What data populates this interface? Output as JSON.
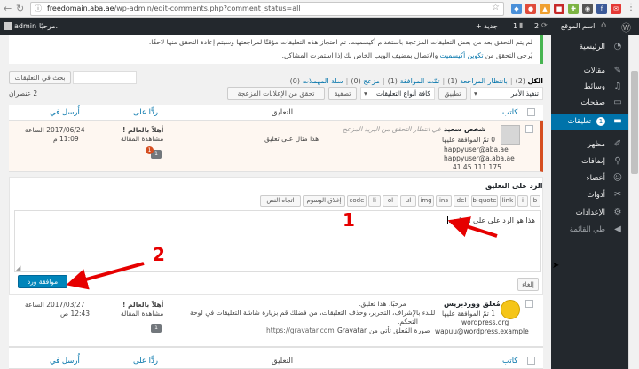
{
  "browser": {
    "url_host": "freedomain.aba.ae",
    "url_path": "/wp-admin/edit-comments.php?comment_status=all"
  },
  "adminbar": {
    "site_name": "اسم الموقع",
    "updates": "2",
    "comments": "1",
    "new": "+ جديد",
    "greeting": "مرحبًا،",
    "user": "admin"
  },
  "sidebar": {
    "items": [
      {
        "label": "الرئيسية",
        "icon": "dashboard-icon"
      },
      {
        "label": "مقالات",
        "icon": "pin-icon"
      },
      {
        "label": "وسائط",
        "icon": "media-icon"
      },
      {
        "label": "صفحات",
        "icon": "page-icon"
      },
      {
        "label": "تعليقات",
        "icon": "comment-icon",
        "badge": "1",
        "active": true
      },
      {
        "label": "مظهر",
        "icon": "brush-icon"
      },
      {
        "label": "إضافات",
        "icon": "plugin-icon"
      },
      {
        "label": "أعضاء",
        "icon": "users-icon"
      },
      {
        "label": "أدوات",
        "icon": "tools-icon"
      },
      {
        "label": "الإعدادات",
        "icon": "settings-icon"
      },
      {
        "label": "طي القائمة",
        "icon": "collapse-icon"
      }
    ]
  },
  "notice": {
    "line1": "لم يتم التحقق بعد من بعض التعليقات المزعجة باستخدام أكيسميت. تم احتجاز هذه التعليقات مؤقتًا لمراجعتها وسيتم إعادة التحقق منها لاحقًا.",
    "line2_pre": "يُرجى التحقق من",
    "line2_link": "تكوين أكيسميت",
    "line2_post": "والاتصال بمضيف الويب الخاص بك إذا استمرت المشاكل."
  },
  "search": {
    "button": "بحث في التعليقات",
    "value": ""
  },
  "filters": {
    "all": "الكل",
    "all_count": "(2)",
    "pending": "بانتظار المراجعة",
    "pending_count": "(1)",
    "approved": "تمّت الموافقة",
    "approved_count": "(1)",
    "spam": "مزعج",
    "spam_count": "(0)",
    "trash": "سلة المهملات",
    "trash_count": "(0)"
  },
  "bulk": {
    "action": "تنفيذ الأمر",
    "apply": "تطبيق",
    "type": "كافة أنواع التعليقات",
    "filter": "تصفية",
    "check_spam": "تحقق من الإعلانات المزعجة",
    "items_count": "2 عنصران"
  },
  "table": {
    "col_author": "كاتب",
    "col_comment": "التعليق",
    "col_response": "ردًّا على",
    "col_submitted": "أُرسل في"
  },
  "comment1": {
    "author": "شخص سعيد",
    "approved_count": "0 تمّ الموافقة عليها",
    "email1": "happyuser@aba.ae",
    "email2": "happyuser@a.aba.ae",
    "ip": "41.45.111.175",
    "status_note": "في انتظار التحقق من البريد المزعج",
    "text": "هذا مثال على تعليق",
    "response_title": "أهلاً بالعالم !",
    "response_view": "مشاهدة المقالة",
    "response_count": "1",
    "response_pending": "1",
    "date": "2017/06/24 الساعة",
    "time": "11:09 م"
  },
  "reply": {
    "title": "الرد على التعليق",
    "quicktags": [
      "b",
      "i",
      "link",
      "b-quote",
      "del",
      "ins",
      "img",
      "ul",
      "ol",
      "li",
      "code",
      "إغلاق الوسوم",
      "اتجاه النص"
    ],
    "text": "هذا هو الرد على على التعليق.",
    "cancel": "إلغاء",
    "submit": "موافقة ورد"
  },
  "comment2": {
    "author": "مُعلق ووردبريس",
    "approved_count": "1 تمّ الموافقة عليها",
    "site": "wordpress.org",
    "email": "wapuu@wordpress.example",
    "text_l1": "مرحبًا، هذا تعليق.",
    "text_l2": "للبدء بالإشراف، التحرير، وحذف التعليقات، من فضلك قم بزيارة شاشة التعليقات في لوحة",
    "text_l3": "التحكم.",
    "text_l4_pre": "صورة المُعلق تأتي من",
    "text_l4_link": "Gravatar",
    "text_l4_url": "https://gravatar.com",
    "response_title": "أهلاً بالعالم !",
    "response_view": "مشاهدة المقالة",
    "response_count": "1",
    "date": "2017/03/27 الساعة",
    "time": "12:43 ص"
  },
  "annotations": {
    "one": "1",
    "two": "2",
    "color": "#e60000"
  }
}
